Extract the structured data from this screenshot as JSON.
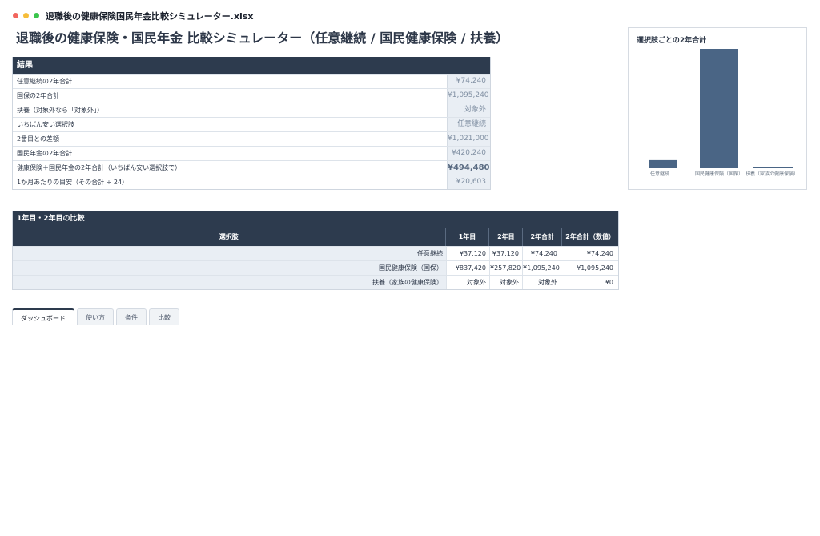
{
  "window": {
    "filename": "退職後の健康保険国民年金比較シミュレーター.xlsx"
  },
  "page_title": "退職後の健康保険・国民年金 比較シミュレーター（任意継続 / 国民健康保険 / 扶養）",
  "results": {
    "header": "結果",
    "rows": [
      {
        "label": "任意継続の2年合計",
        "value": "¥74,240"
      },
      {
        "label": "国保の2年合計",
        "value": "¥1,095,240"
      },
      {
        "label": "扶養（対象外なら「対象外」）",
        "value": "対象外"
      },
      {
        "label": "いちばん安い選択肢",
        "value": "任意継続"
      },
      {
        "label": "2番目との差額",
        "value": "¥1,021,000"
      },
      {
        "label": "国民年金の2年合計",
        "value": "¥420,240"
      },
      {
        "label": "健康保険＋国民年金の2年合計（いちばん安い選択肢で）",
        "value": "¥494,480"
      },
      {
        "label": "1か月あたりの目安（その合計 ÷ 24）",
        "value": "¥20,603"
      }
    ]
  },
  "chart": {
    "title": "選択肢ごとの2年合計",
    "color": "#4a6585",
    "axis_color": "#2d3748"
  },
  "chart_data": {
    "type": "bar",
    "title": "選択肢ごとの2年合計",
    "categories": [
      "任意継続",
      "国民健康保険（国保）",
      "扶養（家族の健康保険）"
    ],
    "values": [
      74240,
      1095240,
      0
    ],
    "ylim": [
      0,
      1095240
    ],
    "xlabel": "",
    "ylabel": "",
    "grid": false,
    "legend": "none"
  },
  "compare": {
    "header": "1年目・2年目の比較",
    "columns": [
      "選択肢",
      "1年目",
      "2年目",
      "2年合計",
      "2年合計（数値）"
    ],
    "rows": [
      [
        "任意継続",
        "¥37,120",
        "¥37,120",
        "¥74,240",
        "¥74,240"
      ],
      [
        "国民健康保険（国保）",
        "¥837,420",
        "¥257,820",
        "¥1,095,240",
        "¥1,095,240"
      ],
      [
        "扶養（家族の健康保険）",
        "対象外",
        "対象外",
        "対象外",
        "¥0"
      ]
    ]
  },
  "tabs": [
    {
      "label": "ダッシュボード",
      "active": true
    },
    {
      "label": "使い方",
      "active": false
    },
    {
      "label": "条件",
      "active": false
    },
    {
      "label": "比較",
      "active": false
    }
  ]
}
